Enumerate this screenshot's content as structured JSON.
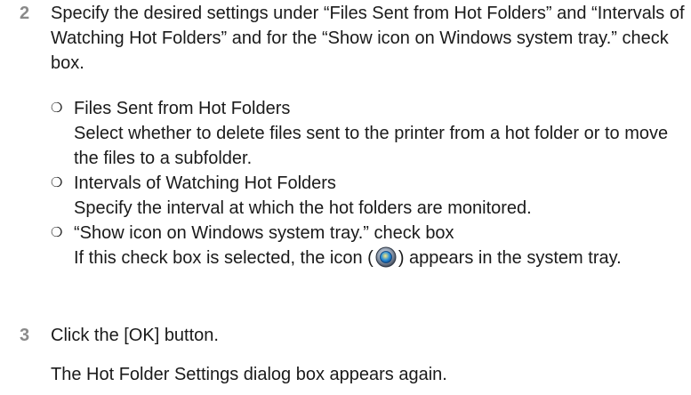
{
  "steps": [
    {
      "number": "2",
      "text": "Specify the desired settings under “Files Sent from Hot Folders” and “Intervals of Watching Hot Folders” and for the “Show icon on Windows system tray.” check box."
    },
    {
      "number": "3",
      "text": "Click the [OK] button."
    }
  ],
  "bullets": [
    {
      "mark": "❍",
      "title": "Files Sent from Hot Folders",
      "body": "Select whether to delete files sent to the printer from a hot folder or to move the files to a subfolder."
    },
    {
      "mark": "❍",
      "title": "Intervals of Watching Hot Folders",
      "body": "Specify the interval at which the hot folders are monitored."
    },
    {
      "mark": "❍",
      "title": "“Show icon on Windows system tray.” check box",
      "body_before_icon": "If this check box is selected, the icon (",
      "body_after_icon": ") appears in the system tray.",
      "icon": "hot-folder-tray-icon"
    }
  ],
  "result_text": "The Hot Folder Settings dialog box appears again.",
  "colors": {
    "step_number": "#8a8a8a",
    "text": "#1a1a1a"
  }
}
